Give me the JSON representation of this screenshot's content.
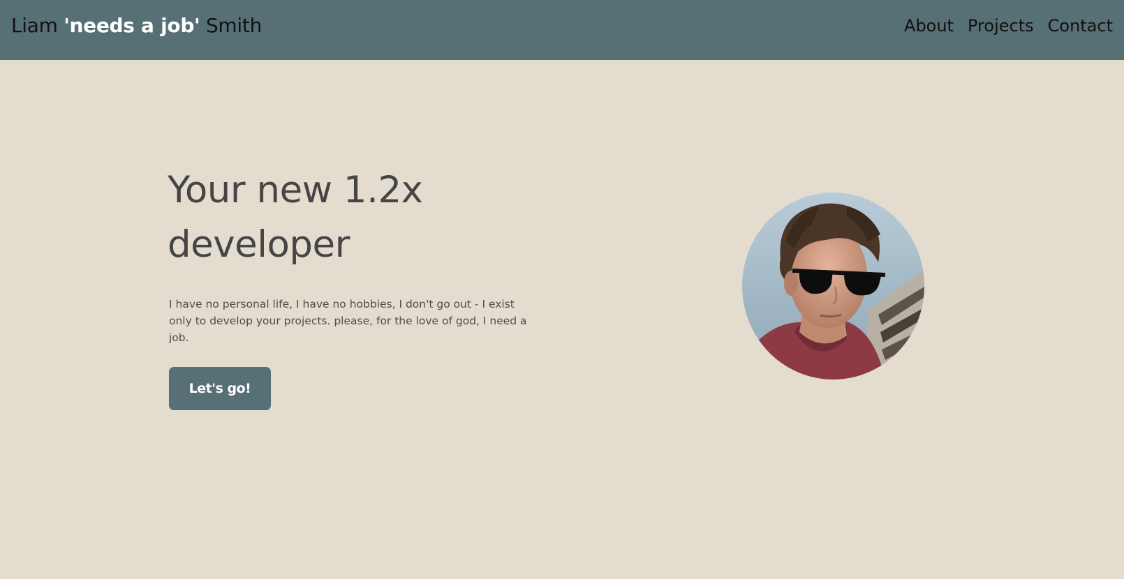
{
  "header": {
    "brand_first": "Liam ",
    "brand_nickname": "'needs a job'",
    "brand_last": " Smith",
    "nav": {
      "about": "About",
      "projects": "Projects",
      "contact": "Contact"
    }
  },
  "hero": {
    "title": "Your new 1.2x developer",
    "description": "I have no personal life, I have no hobbies, I don't go out - I exist only to develop your projects. please, for the love of god, I need a job.",
    "cta_label": "Let's go!"
  },
  "colors": {
    "header_bg": "#577075",
    "page_bg": "#e4dccf",
    "button_bg": "#577075"
  }
}
